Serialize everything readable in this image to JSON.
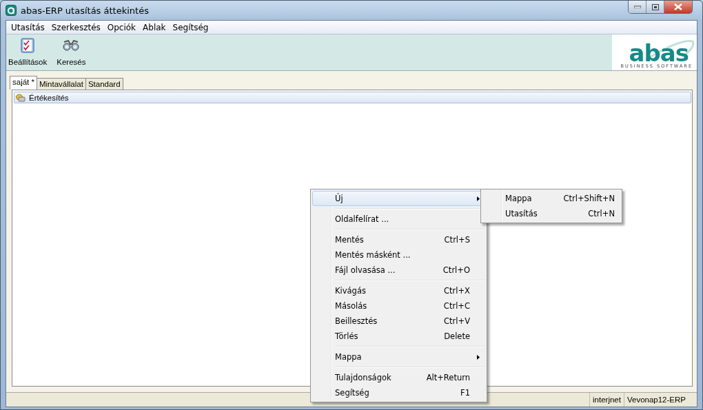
{
  "window": {
    "title": "abas-ERP utasítás áttekintés"
  },
  "menubar": [
    "Utasítás",
    "Szerkesztés",
    "Opciók",
    "Ablak",
    "Segítség"
  ],
  "toolbar": [
    {
      "label": "Beállítások",
      "kind": "settings"
    },
    {
      "label": "Keresés",
      "kind": "search"
    }
  ],
  "logo": {
    "name": "abas",
    "tagline": "BUSINESS SOFTWARE"
  },
  "tabs": [
    {
      "label": "saját *",
      "selected": true
    },
    {
      "label": "Mintavállalat",
      "selected": false
    },
    {
      "label": "Standard",
      "selected": false
    }
  ],
  "tree": [
    {
      "label": "Értékesítés",
      "selected": true
    }
  ],
  "context_menu": [
    {
      "kind": "item",
      "label": "Új",
      "submenu": true,
      "selected": true
    },
    {
      "kind": "separator"
    },
    {
      "kind": "item",
      "label": "Oldalfelírat ...",
      "submenu": false,
      "selected": false
    },
    {
      "kind": "separator"
    },
    {
      "kind": "item",
      "label": "Mentés",
      "shortcut": "Ctrl+S",
      "submenu": false,
      "selected": false
    },
    {
      "kind": "item",
      "label": "Mentés másként ...",
      "submenu": false,
      "selected": false
    },
    {
      "kind": "item",
      "label": "Fájl olvasása ...",
      "shortcut": "Ctrl+O",
      "submenu": false,
      "selected": false
    },
    {
      "kind": "separator"
    },
    {
      "kind": "item",
      "label": "Kivágás",
      "shortcut": "Ctrl+X",
      "submenu": false,
      "selected": false
    },
    {
      "kind": "item",
      "label": "Másolás",
      "shortcut": "Ctrl+C",
      "submenu": false,
      "selected": false
    },
    {
      "kind": "item",
      "label": "Beillesztés",
      "shortcut": "Ctrl+V",
      "submenu": false,
      "selected": false
    },
    {
      "kind": "item",
      "label": "Törlés",
      "shortcut": "Delete",
      "submenu": false,
      "selected": false
    },
    {
      "kind": "separator"
    },
    {
      "kind": "item",
      "label": "Mappa",
      "submenu": true,
      "selected": false
    },
    {
      "kind": "separator"
    },
    {
      "kind": "item",
      "label": "Tulajdonságok",
      "shortcut": "Alt+Return",
      "submenu": false,
      "selected": false
    },
    {
      "kind": "item",
      "label": "Segítség",
      "shortcut": "F1",
      "submenu": false,
      "selected": false
    }
  ],
  "submenu": [
    {
      "label": "Mappa",
      "shortcut": "Ctrl+Shift+N"
    },
    {
      "label": "Utasítás",
      "shortcut": "Ctrl+N"
    }
  ],
  "status_bar": [
    "interjnet",
    "Vevonap12-ERP"
  ]
}
